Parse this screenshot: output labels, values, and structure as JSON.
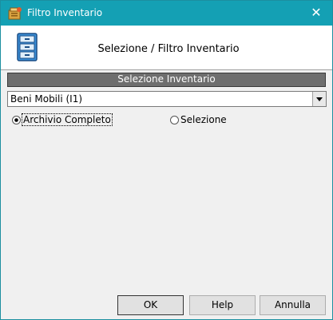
{
  "window": {
    "title": "Filtro Inventario",
    "close_glyph": "✕",
    "title_icon": "inventory-app-icon"
  },
  "header": {
    "title": "Selezione / Filtro Inventario",
    "icon": "cabinet-icon"
  },
  "section": {
    "label": "Selezione Inventario"
  },
  "inventory_select": {
    "value": "Beni Mobili (I1)"
  },
  "scope_radios": {
    "options": [
      {
        "label": "Archivio Completo",
        "selected": true
      },
      {
        "label": "Selezione",
        "selected": false
      }
    ]
  },
  "buttons": {
    "ok": "OK",
    "help": "Help",
    "cancel": "Annulla"
  },
  "colors": {
    "titlebar": "#14a0b4",
    "section_header": "#6e6e6e",
    "window_bg": "#f0f0f0"
  }
}
